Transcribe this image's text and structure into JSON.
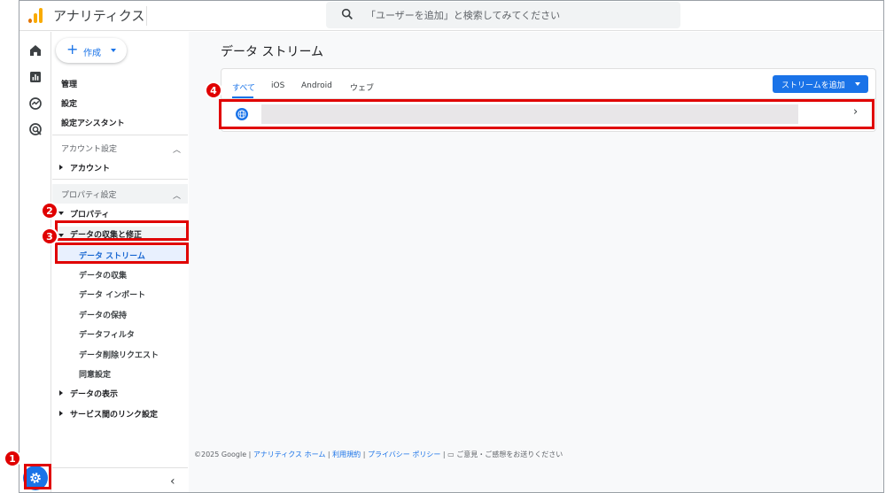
{
  "header": {
    "app_title": "アナリティクス",
    "search_placeholder": "「ユーザーを追加」と検索してみてください"
  },
  "rail": {
    "icons": [
      "home-icon",
      "reports-icon",
      "explore-icon",
      "advertising-icon"
    ],
    "admin_icon": "gear-icon"
  },
  "nav": {
    "create_label": "作成",
    "top_items": [
      "管理",
      "設定",
      "設定アシスタント"
    ],
    "account_section": "アカウント設定",
    "account_item": "アカウント",
    "property_section": "プロパティ設定",
    "property_item": "プロパティ",
    "data_collection": "データの収集と修正",
    "sub_items": [
      "データ ストリーム",
      "データの収集",
      "データ インポート",
      "データの保持",
      "データフィルタ",
      "データ削除リクエスト",
      "同意設定"
    ],
    "data_display": "データの表示",
    "service_links": "サービス間のリンク設定"
  },
  "main": {
    "page_title": "データ ストリーム",
    "tabs": [
      "すべて",
      "iOS",
      "Android",
      "ウェブ"
    ],
    "add_stream_label": "ストリームを追加"
  },
  "footer": {
    "copyright": "©2025 Google",
    "sep": "|",
    "links": [
      "アナリティクス ホーム",
      "利用規約",
      "プライバシー ポリシー"
    ],
    "feedback": "ご意見・ご感想をお送りください"
  },
  "annotations": [
    "1",
    "2",
    "3",
    "4"
  ],
  "colors": {
    "accent": "#1a73e8",
    "annotation": "#e00000"
  }
}
